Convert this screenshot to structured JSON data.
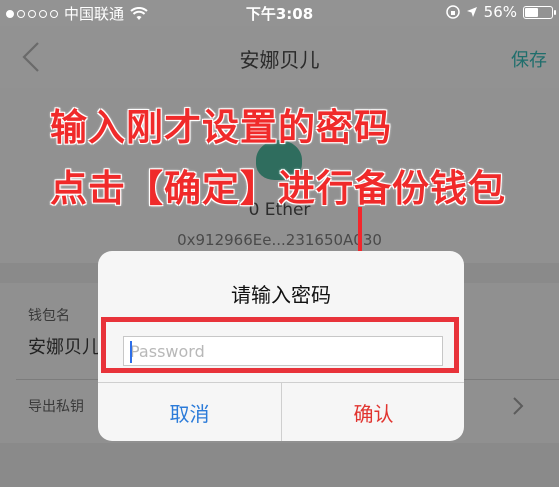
{
  "status_bar": {
    "carrier": "中国联通",
    "time": "下午3:08",
    "battery_percent": "56%",
    "battery_level": 0.56,
    "signal_bars_filled": 1,
    "signal_bars_total": 5
  },
  "nav": {
    "title": "安娜贝儿",
    "save_label": "保存"
  },
  "wallet": {
    "balance": "0 Ether",
    "address": "0x912966Ee...231650A030"
  },
  "fields": {
    "name_label": "钱包名",
    "name_value": "安娜贝儿",
    "export_label": "导出私钥"
  },
  "annotation": {
    "line1": "输入刚才设置的密码",
    "line2": "点击【确定】进行备份钱包"
  },
  "dialog": {
    "title": "请输入密码",
    "password_placeholder": "Password",
    "password_value": "",
    "cancel_label": "取消",
    "confirm_label": "确认"
  },
  "colors": {
    "annotation_red": "#f02a2a",
    "cancel_blue": "#2b7bd9",
    "confirm_red": "#e1342f",
    "save_teal": "#1f6e6c"
  }
}
